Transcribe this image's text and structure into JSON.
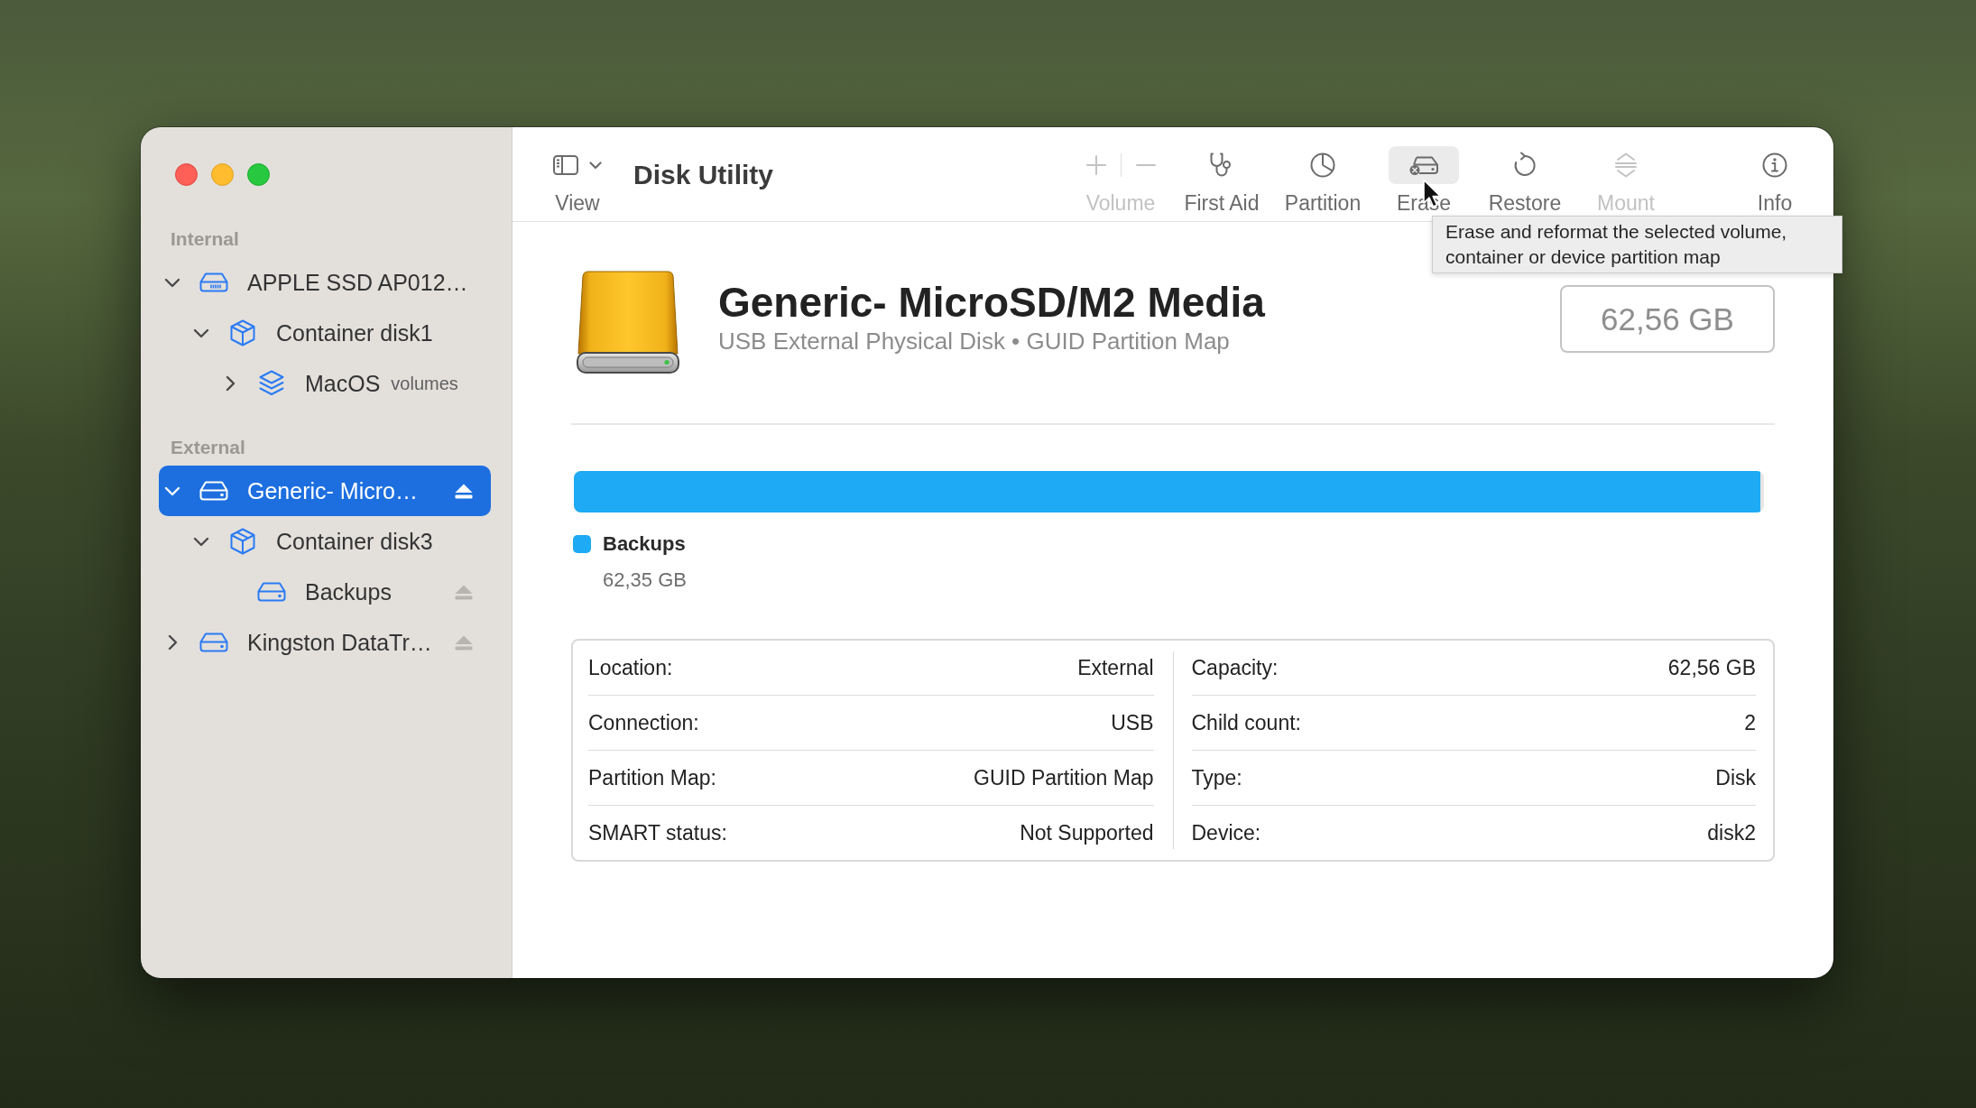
{
  "window": {
    "title": "Disk Utility"
  },
  "toolbar": {
    "view": {
      "label": "View"
    },
    "buttons": [
      {
        "kind": "volume",
        "label": "Volume",
        "disabled": true,
        "hovered": false
      },
      {
        "kind": "firstaid",
        "label": "First Aid",
        "disabled": false,
        "hovered": false
      },
      {
        "kind": "partition",
        "label": "Partition",
        "disabled": false,
        "hovered": false
      },
      {
        "kind": "erase",
        "label": "Erase",
        "disabled": false,
        "hovered": true
      },
      {
        "kind": "restore",
        "label": "Restore",
        "disabled": false,
        "hovered": false
      },
      {
        "kind": "mount",
        "label": "Mount",
        "disabled": true,
        "hovered": false
      },
      {
        "kind": "info",
        "label": "Info",
        "disabled": false,
        "hovered": false
      }
    ]
  },
  "tooltip": {
    "text": "Erase and reformat the selected volume, container or device partition map"
  },
  "sidebar": {
    "sections": [
      {
        "heading": "Internal",
        "items": [
          {
            "label": "APPLE SSD AP012…",
            "kind": "ssd",
            "expanded": true,
            "selected": false,
            "ejectable": false,
            "children": [
              {
                "label": "Container disk1",
                "kind": "container",
                "expanded": true,
                "selected": false,
                "ejectable": false,
                "children": [
                  {
                    "label": "MacOS",
                    "note": "volumes",
                    "kind": "volumes",
                    "expanded": false,
                    "selected": false,
                    "ejectable": false
                  }
                ]
              }
            ]
          }
        ]
      },
      {
        "heading": "External",
        "items": [
          {
            "label": "Generic- Micro…",
            "kind": "drive",
            "expanded": true,
            "selected": true,
            "ejectable": true,
            "children": [
              {
                "label": "Container disk3",
                "kind": "container",
                "expanded": true,
                "selected": false,
                "ejectable": false,
                "children": [
                  {
                    "label": "Backups",
                    "kind": "volume",
                    "selected": false,
                    "ejectable": true
                  }
                ]
              }
            ]
          },
          {
            "label": "Kingston DataTr…",
            "kind": "drive",
            "expanded": false,
            "selected": false,
            "ejectable": true
          }
        ]
      }
    ]
  },
  "device": {
    "name": "Generic- MicroSD/M2 Media",
    "description": "USB External Physical Disk • GUID Partition Map",
    "capacity": "62,56 GB"
  },
  "usage": {
    "segments": [
      {
        "name": "Backups",
        "size": "62,35 GB",
        "color": "#1eaaf5",
        "level": 0.997
      }
    ]
  },
  "details": {
    "columns": [
      {
        "rows": [
          {
            "label": "Location:",
            "value": "External"
          },
          {
            "label": "Connection:",
            "value": "USB"
          },
          {
            "label": "Partition Map:",
            "value": "GUID Partition Map"
          },
          {
            "label": "SMART status:",
            "value": "Not Supported"
          }
        ]
      },
      {
        "rows": [
          {
            "label": "Capacity:",
            "value": "62,56 GB"
          },
          {
            "label": "Child count:",
            "value": "2"
          },
          {
            "label": "Type:",
            "value": "Disk"
          },
          {
            "label": "Device:",
            "value": "disk2"
          }
        ]
      }
    ]
  }
}
